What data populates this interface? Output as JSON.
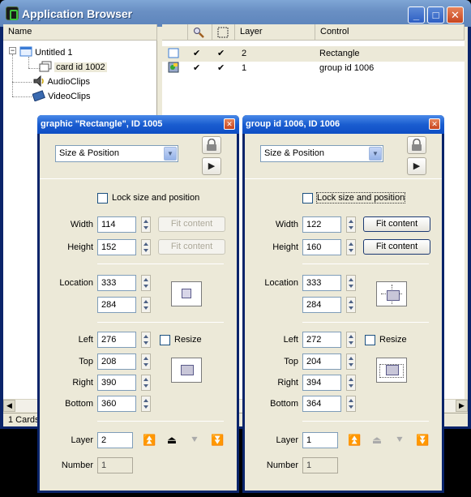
{
  "app": {
    "title": "Application Browser",
    "buttons": {
      "minimize": "_",
      "maximize": "□",
      "close": "✕"
    }
  },
  "tree": {
    "header": "Name",
    "expander": "−",
    "items": [
      {
        "label": "Untitled 1"
      },
      {
        "label": "card id 1002"
      },
      {
        "label": "AudioClips"
      },
      {
        "label": "VideoClips"
      }
    ]
  },
  "list": {
    "columns": {
      "layer": "Layer",
      "control": "Control"
    },
    "rows": [
      {
        "check1": "✔",
        "check2": "✔",
        "layer": "2",
        "control": "Rectangle"
      },
      {
        "check1": "✔",
        "check2": "✔",
        "layer": "1",
        "control": "group id 1006"
      }
    ]
  },
  "status": {
    "text": "1 Cards"
  },
  "inspectors": [
    {
      "title": "graphic \"Rectangle\", ID 1005",
      "section": "Size & Position",
      "lock_label": "Lock size and position",
      "labels": {
        "width": "Width",
        "height": "Height",
        "location": "Location",
        "left": "Left",
        "top": "Top",
        "right": "Right",
        "bottom": "Bottom",
        "resize": "Resize",
        "layer": "Layer",
        "number": "Number"
      },
      "width": "114",
      "height": "152",
      "loc_x": "333",
      "loc_y": "284",
      "left": "276",
      "top": "208",
      "right": "390",
      "bottom": "360",
      "layer": "2",
      "number": "1",
      "fit_label": "Fit content",
      "fit_enabled": false
    },
    {
      "title": "group id 1006, ID 1006",
      "section": "Size & Position",
      "lock_label": "Lock size and position",
      "labels": {
        "width": "Width",
        "height": "Height",
        "location": "Location",
        "left": "Left",
        "top": "Top",
        "right": "Right",
        "bottom": "Bottom",
        "resize": "Resize",
        "layer": "Layer",
        "number": "Number"
      },
      "width": "122",
      "height": "160",
      "loc_x": "333",
      "loc_y": "284",
      "left": "272",
      "top": "204",
      "right": "394",
      "bottom": "364",
      "layer": "1",
      "number": "1",
      "fit_label": "Fit content",
      "fit_enabled": true
    }
  ],
  "icons": {
    "lock": "lock-icon",
    "play": "▶",
    "search": "search-icon",
    "dotted_box": "dotted-box-icon"
  }
}
